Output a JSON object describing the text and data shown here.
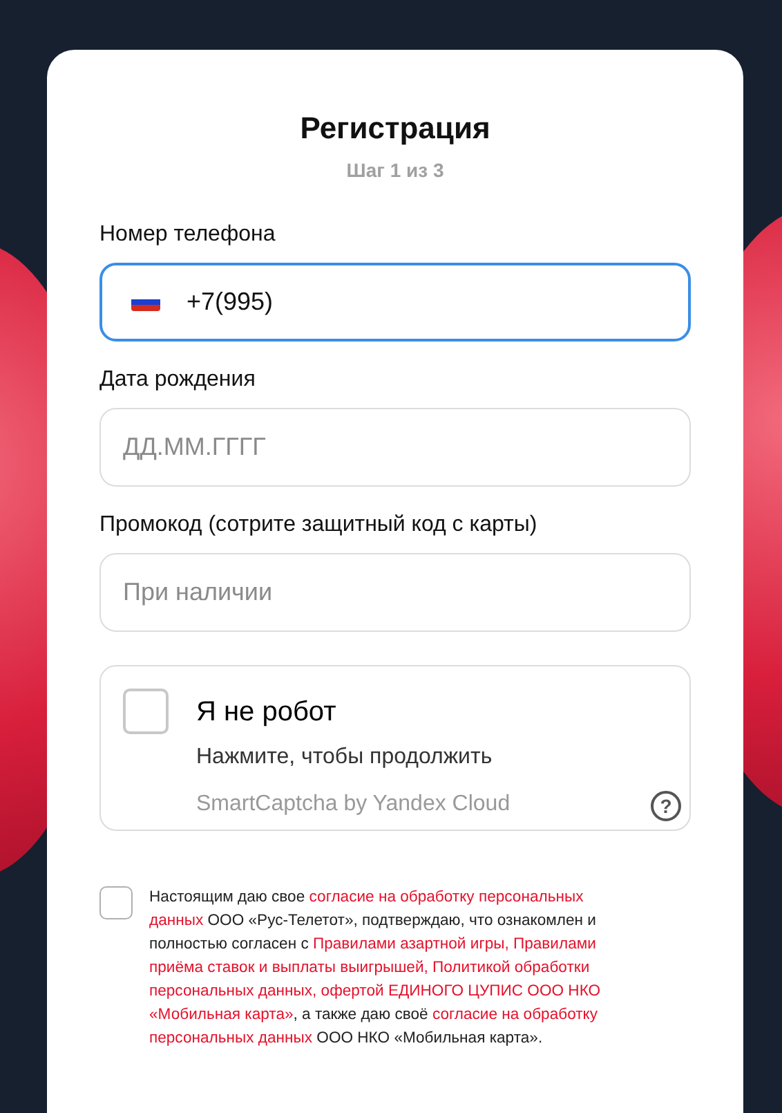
{
  "title": "Регистрация",
  "step": "Шаг 1 из 3",
  "fields": [
    {
      "kind": "phone",
      "label": "Номер телефона",
      "value": "+7(995)",
      "focused": true
    },
    {
      "kind": "text",
      "label": "Дата рождения",
      "placeholder": "ДД.ММ.ГГГГ",
      "focused": false
    },
    {
      "kind": "text",
      "label": "Промокод (сотрите защитный код с карты)",
      "placeholder": "При наличии",
      "focused": false
    }
  ],
  "captcha": {
    "checked": false,
    "title": "Я не робот",
    "hint": "Нажмите, чтобы продолжить",
    "brand": "SmartCaptcha by Yandex Cloud",
    "help": "?"
  },
  "consent": {
    "checked": false,
    "lines": [
      [
        {
          "text": "Настоящим даю свое ",
          "link": false
        },
        {
          "text": "согласие на обработку персональных",
          "link": true
        }
      ],
      [
        {
          "text": "данных",
          "link": true
        },
        {
          "text": " ООО «Рус-Телетот», подтверждаю, что ознакомлен и",
          "link": false
        }
      ],
      [
        {
          "text": "полностью согласен с ",
          "link": false
        },
        {
          "text": "Правилами азартной игры, Правилами",
          "link": true
        }
      ],
      [
        {
          "text": "приёма ставок и выплаты выигрышей, Политикой обработки",
          "link": true
        }
      ],
      [
        {
          "text": "персональных данных, офертой ЕДИНОГО ЦУПИС ООО НКО",
          "link": true
        }
      ],
      [
        {
          "text": "«Мобильная карта»",
          "link": true
        },
        {
          "text": ", а также даю своё ",
          "link": false
        },
        {
          "text": "согласие на обработку",
          "link": true
        }
      ],
      [
        {
          "text": "персональных данных",
          "link": true
        },
        {
          "text": " ООО НКО «Мобильная карта».",
          "link": false
        }
      ]
    ]
  }
}
